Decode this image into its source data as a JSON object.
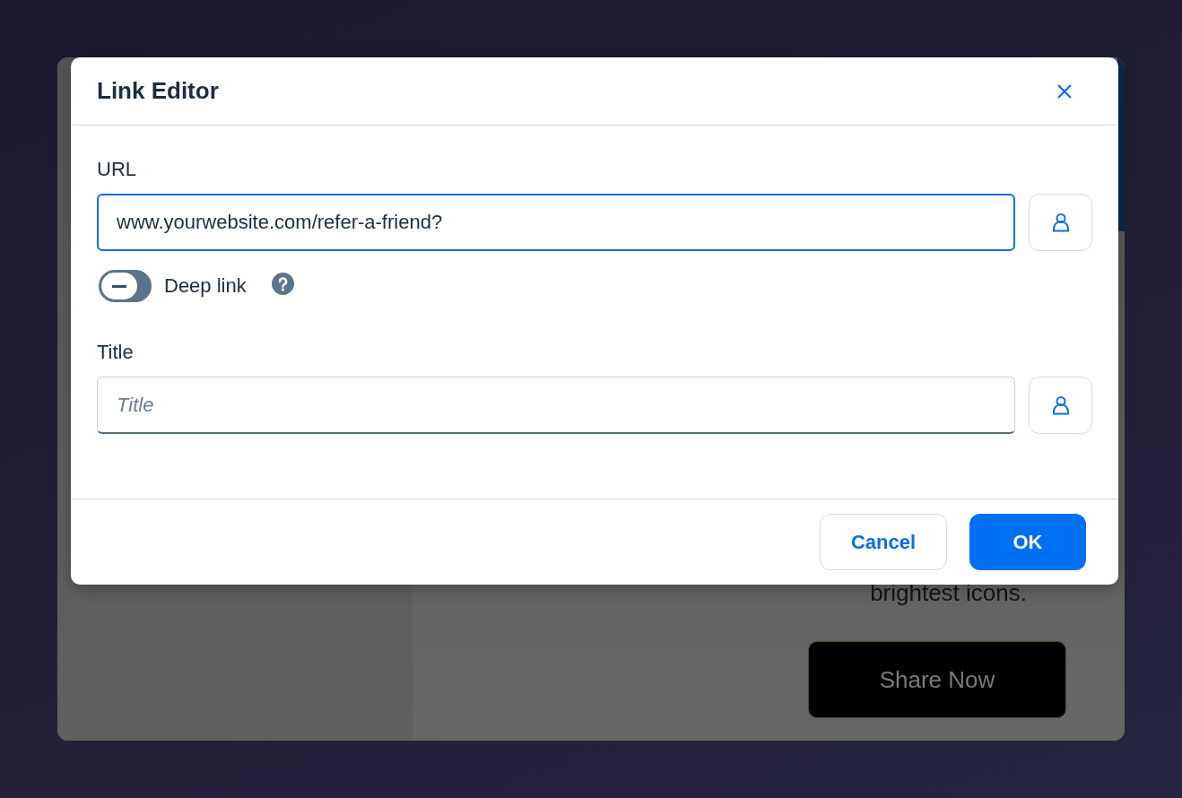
{
  "background_page": {
    "text": "brightest icons.",
    "button": "Share Now"
  },
  "dialog": {
    "title": "Link Editor",
    "fields": [
      {
        "label": "URL",
        "value": "www.yourwebsite.com/refer-a-friend?",
        "focused": true
      },
      {
        "label": "Title",
        "placeholder": "Title",
        "focused": false
      }
    ],
    "deep_link_toggle": {
      "label": "Deep link",
      "on": false
    },
    "buttons": [
      {
        "label": "Cancel",
        "kind": "secondary"
      },
      {
        "label": "OK",
        "kind": "primary"
      }
    ]
  }
}
